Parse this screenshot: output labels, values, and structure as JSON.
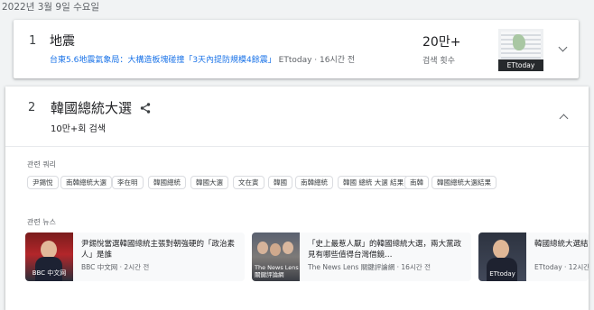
{
  "date": "2022년 3월 9일 수요일",
  "items": [
    {
      "rank": "1",
      "title": "地震",
      "article_link": "台東5.6地震氣象局：大構造板塊碰撞「3天內提防規模4餘震」",
      "article_source": " ETtoday · 16시간 전",
      "count": "20만+",
      "count_label": "검색 횟수",
      "thumb_caption": "ETtoday"
    },
    {
      "rank": "2",
      "title": "韓國總統大選",
      "count": "10만+회 검색",
      "related_queries_label": "관련 쿼리",
      "related_queries": [
        "尹錫悅",
        "南韓總統大選",
        "李在明",
        "韓國總統",
        "韓國大選",
        "文在寅",
        "韓國",
        "南韓總統",
        "韓國 總統 大選 結果",
        "南韓",
        "韓國總統大選結果"
      ],
      "related_news_label": "관련 뉴스",
      "news": [
        {
          "title": "尹錫悅當選韓國總統主張對朝強硬的「政治素人」是誰",
          "source": "BBC 中文网 · 2시간 전",
          "thumb_caption": "BBC 中文网"
        },
        {
          "title": "「史上最惹人厭」的韓國總統大選，兩大黨政見有哪些值得台灣借鏡…",
          "source": "The News Lens 關鍵評論網 · 16시간 전",
          "thumb_caption_1": "The News Lens",
          "thumb_caption_2": "關鍵評論網"
        },
        {
          "title": "韓國總統大選結",
          "source": "ETtoday · 12시간",
          "thumb_caption": "ETtoday"
        }
      ]
    }
  ],
  "colors": {
    "link": "#1a73e8",
    "muted": "#5f6368",
    "background": "#f1f3f4"
  },
  "icons": [
    "share-icon",
    "chevron-down-icon",
    "chevron-up-icon"
  ]
}
